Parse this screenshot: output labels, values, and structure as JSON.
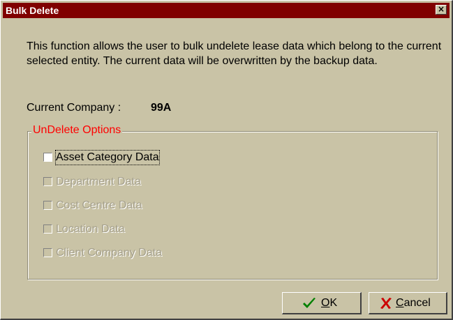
{
  "window": {
    "title": "Bulk Delete",
    "close_glyph": "×"
  },
  "description": "This function allows the user to bulk undelete lease data which belong to the current selected entity. The current data will be overwritten by the backup data.",
  "company": {
    "label": "Current Company :",
    "value": "99A"
  },
  "options": {
    "legend": "UnDelete Options",
    "items": [
      {
        "label": "Asset Category Data",
        "checked": false,
        "enabled": true
      },
      {
        "label": "Department Data",
        "checked": false,
        "enabled": false
      },
      {
        "label": "Cost Centre Data",
        "checked": false,
        "enabled": false
      },
      {
        "label": "Location Data",
        "checked": false,
        "enabled": false
      },
      {
        "label": "Client Company Data",
        "checked": false,
        "enabled": false
      }
    ]
  },
  "buttons": {
    "ok": {
      "mnemonic": "O",
      "rest": "K",
      "icon": "checkmark-icon"
    },
    "cancel": {
      "mnemonic": "C",
      "rest": "ancel",
      "icon": "x-icon"
    }
  },
  "colors": {
    "titlebar": "#800000",
    "dialog_bg": "#c9c3a6",
    "legend_text": "#ff0000",
    "ok_icon": "#008000",
    "cancel_icon": "#cc0000"
  }
}
